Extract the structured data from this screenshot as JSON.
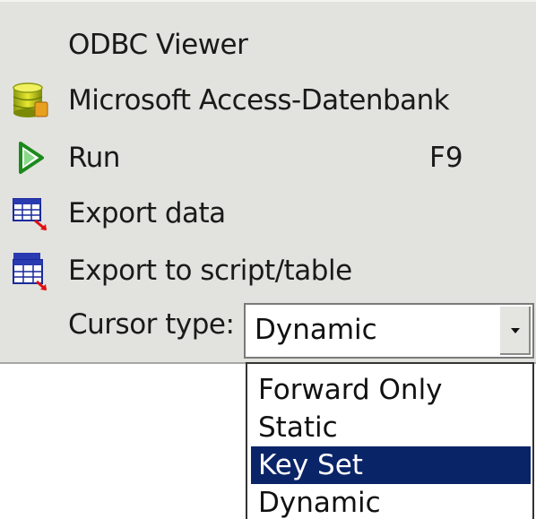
{
  "menu": {
    "items": [
      {
        "label": "ODBC Viewer",
        "icon": "none",
        "shortcut": ""
      },
      {
        "label": "Microsoft Access-Datenbank",
        "icon": "database-icon",
        "shortcut": ""
      },
      {
        "label": "Run",
        "icon": "play-icon",
        "shortcut": "F9"
      },
      {
        "label": "Export data",
        "icon": "export-data-icon",
        "shortcut": ""
      },
      {
        "label": "Export to script/table",
        "icon": "export-script-icon",
        "shortcut": ""
      }
    ],
    "cursor_type": {
      "label": "Cursor type:",
      "value": "Dynamic",
      "options": [
        "Forward Only",
        "Static",
        "Key Set",
        "Dynamic"
      ],
      "highlighted": "Key Set"
    }
  },
  "colors": {
    "panel_bg": "#e2e2de",
    "highlight_bg": "#0a2468",
    "highlight_text": "#ffffff"
  }
}
